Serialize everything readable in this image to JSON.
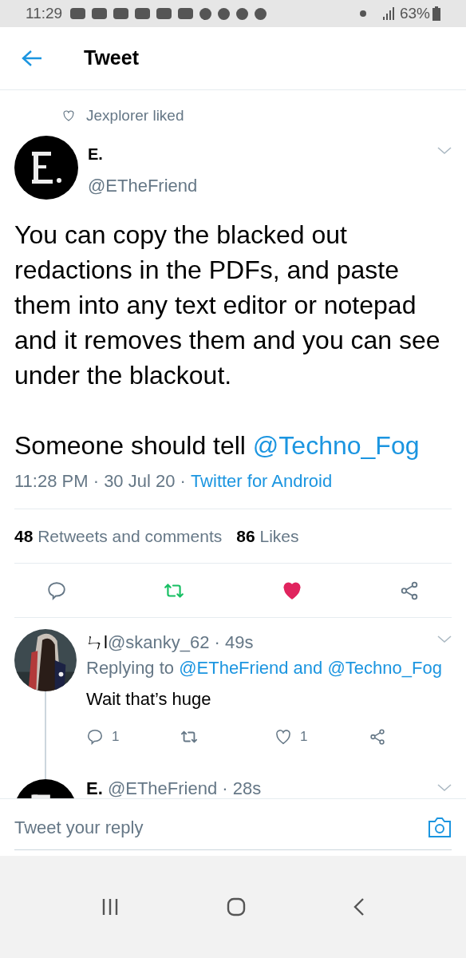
{
  "status_bar": {
    "time": "11:29",
    "battery": "63%"
  },
  "header": {
    "title": "Tweet"
  },
  "social_context": "Jexplorer liked",
  "tweet": {
    "name": "E.",
    "handle": "@ETheFriend",
    "paragraphs": [
      "You can copy the blacked out redactions in the PDFs, and paste them into any text editor or notepad  and it removes them and you can see under the blackout."
    ],
    "closing_text": "Someone should tell",
    "closing_mention": "@Techno_Fog",
    "separator": "·",
    "time": "11:28 PM",
    "date": "30 Jul 20",
    "source": "Twitter for Android",
    "retweets_count": "48",
    "retweets_label": "Retweets and comments",
    "likes_count": "86",
    "likes_label": "Likes",
    "retweeted": true,
    "liked": true
  },
  "replies": [
    {
      "name": "ㄣl",
      "handle": "@skanky_62",
      "separator": "·",
      "age": "49s",
      "replying_prefix": "Replying to",
      "mentions": [
        "@ETheFriend",
        "@Techno_Fog"
      ],
      "conjunction": "and",
      "text": "Wait that’s huge",
      "reply_count": "1",
      "like_count": "1",
      "liked": false
    },
    {
      "name": "E.",
      "handle": "@ETheFriend",
      "separator": "·",
      "age": "28s"
    }
  ],
  "reply_field": {
    "placeholder": "Tweet your reply"
  }
}
